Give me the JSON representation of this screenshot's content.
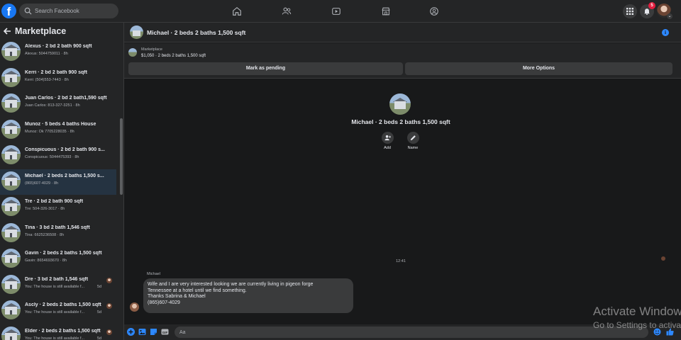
{
  "search": {
    "placeholder": "Search Facebook"
  },
  "notifications": {
    "count": "5"
  },
  "sidebar": {
    "title": "Marketplace",
    "conversations": [
      {
        "title": "Alexus · 2 bd 2 bath 900 sqft",
        "subtitle": "Alexus: 5044759011 · 8h",
        "time": ""
      },
      {
        "title": "Kerri · 2 bd 2 bath 900 sqft",
        "subtitle": "Kerri: (504)553-7443 · 8h",
        "time": ""
      },
      {
        "title": "Juan Carlos · 2 bd 2 bath1,590 sqft",
        "subtitle": "Juan Carlos: 813-327-3251 · 8h",
        "time": ""
      },
      {
        "title": "Munoz · 5 beds 4 baths House",
        "subtitle": "Munoz: Ok 7705228035 · 8h",
        "time": ""
      },
      {
        "title": "Conspicuous · 2 bd 2 bath 900 s...",
        "subtitle": "Conspicuous: 5044475393 · 8h",
        "time": ""
      },
      {
        "title": "Michael · 2 beds 2 baths 1,500 s...",
        "subtitle": "(865)607-4029 · 8h",
        "time": ""
      },
      {
        "title": "Tre · 2 bd 2 bath 900 sqft",
        "subtitle": "Tre: 504-326-3017 · 8h",
        "time": ""
      },
      {
        "title": "Tina · 3 bd 2 bath 1,546 sqft",
        "subtitle": "Tina: 6625236508 · 8h",
        "time": ""
      },
      {
        "title": "Gavin · 2 beds 2 baths 1,500 sqft",
        "subtitle": "Gavin: 8654693670 · 8h",
        "time": ""
      },
      {
        "title": "Dre · 3 bd 2 bath 1,546 sqft",
        "subtitle": "You: The house is still available f...",
        "time": "5d"
      },
      {
        "title": "Ascly · 2 beds 2 baths 1,500 sqft",
        "subtitle": "You: The house is still available f...",
        "time": "5d"
      },
      {
        "title": "Elder · 2 beds 2 baths 1,500 sqft",
        "subtitle": "You: The house is still available f...",
        "time": "5d"
      }
    ]
  },
  "chat": {
    "title": "Michael · 2 beds 2 baths 1,500 sqft",
    "listing": {
      "source": "Marketplace",
      "description": "$1,050 · 2 beds 2 baths 1,500 sqft"
    },
    "mark_pending_label": "Mark as pending",
    "more_options_label": "More Options",
    "profile_name": "Michael · 2 beds 2 baths 1,500 sqft",
    "actions": {
      "add_label": "Add",
      "name_label": "Name"
    },
    "timestamp": "12:41",
    "message": {
      "sender": "Michael",
      "lines": [
        "Wife and I are very interested looking we are currently living in pigeon forge",
        "Tennessee at a hotel until we find something.",
        "Thanks Sabrina & Michael",
        "(865)607-4029"
      ]
    },
    "composer_placeholder": "Aa"
  },
  "watermark": {
    "line1": "Activate Windows",
    "line2": "Go to Settings to activate Windows."
  },
  "colors": {
    "accent": "#1877f2",
    "background": "#18191a",
    "surface": "#242526",
    "bubble": "#3a3b3c"
  }
}
